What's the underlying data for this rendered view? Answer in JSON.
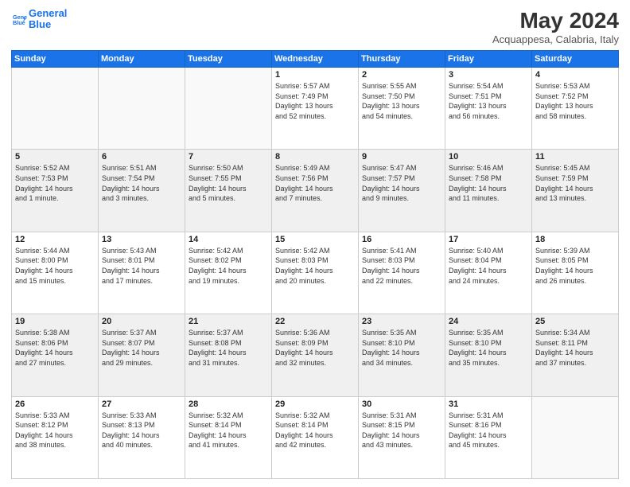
{
  "header": {
    "logo_line1": "General",
    "logo_line2": "Blue",
    "title": "May 2024",
    "subtitle": "Acquappesa, Calabria, Italy"
  },
  "columns": [
    "Sunday",
    "Monday",
    "Tuesday",
    "Wednesday",
    "Thursday",
    "Friday",
    "Saturday"
  ],
  "rows": [
    {
      "shaded": false,
      "days": [
        {
          "num": "",
          "info": ""
        },
        {
          "num": "",
          "info": ""
        },
        {
          "num": "",
          "info": ""
        },
        {
          "num": "1",
          "info": "Sunrise: 5:57 AM\nSunset: 7:49 PM\nDaylight: 13 hours\nand 52 minutes."
        },
        {
          "num": "2",
          "info": "Sunrise: 5:55 AM\nSunset: 7:50 PM\nDaylight: 13 hours\nand 54 minutes."
        },
        {
          "num": "3",
          "info": "Sunrise: 5:54 AM\nSunset: 7:51 PM\nDaylight: 13 hours\nand 56 minutes."
        },
        {
          "num": "4",
          "info": "Sunrise: 5:53 AM\nSunset: 7:52 PM\nDaylight: 13 hours\nand 58 minutes."
        }
      ]
    },
    {
      "shaded": true,
      "days": [
        {
          "num": "5",
          "info": "Sunrise: 5:52 AM\nSunset: 7:53 PM\nDaylight: 14 hours\nand 1 minute."
        },
        {
          "num": "6",
          "info": "Sunrise: 5:51 AM\nSunset: 7:54 PM\nDaylight: 14 hours\nand 3 minutes."
        },
        {
          "num": "7",
          "info": "Sunrise: 5:50 AM\nSunset: 7:55 PM\nDaylight: 14 hours\nand 5 minutes."
        },
        {
          "num": "8",
          "info": "Sunrise: 5:49 AM\nSunset: 7:56 PM\nDaylight: 14 hours\nand 7 minutes."
        },
        {
          "num": "9",
          "info": "Sunrise: 5:47 AM\nSunset: 7:57 PM\nDaylight: 14 hours\nand 9 minutes."
        },
        {
          "num": "10",
          "info": "Sunrise: 5:46 AM\nSunset: 7:58 PM\nDaylight: 14 hours\nand 11 minutes."
        },
        {
          "num": "11",
          "info": "Sunrise: 5:45 AM\nSunset: 7:59 PM\nDaylight: 14 hours\nand 13 minutes."
        }
      ]
    },
    {
      "shaded": false,
      "days": [
        {
          "num": "12",
          "info": "Sunrise: 5:44 AM\nSunset: 8:00 PM\nDaylight: 14 hours\nand 15 minutes."
        },
        {
          "num": "13",
          "info": "Sunrise: 5:43 AM\nSunset: 8:01 PM\nDaylight: 14 hours\nand 17 minutes."
        },
        {
          "num": "14",
          "info": "Sunrise: 5:42 AM\nSunset: 8:02 PM\nDaylight: 14 hours\nand 19 minutes."
        },
        {
          "num": "15",
          "info": "Sunrise: 5:42 AM\nSunset: 8:03 PM\nDaylight: 14 hours\nand 20 minutes."
        },
        {
          "num": "16",
          "info": "Sunrise: 5:41 AM\nSunset: 8:03 PM\nDaylight: 14 hours\nand 22 minutes."
        },
        {
          "num": "17",
          "info": "Sunrise: 5:40 AM\nSunset: 8:04 PM\nDaylight: 14 hours\nand 24 minutes."
        },
        {
          "num": "18",
          "info": "Sunrise: 5:39 AM\nSunset: 8:05 PM\nDaylight: 14 hours\nand 26 minutes."
        }
      ]
    },
    {
      "shaded": true,
      "days": [
        {
          "num": "19",
          "info": "Sunrise: 5:38 AM\nSunset: 8:06 PM\nDaylight: 14 hours\nand 27 minutes."
        },
        {
          "num": "20",
          "info": "Sunrise: 5:37 AM\nSunset: 8:07 PM\nDaylight: 14 hours\nand 29 minutes."
        },
        {
          "num": "21",
          "info": "Sunrise: 5:37 AM\nSunset: 8:08 PM\nDaylight: 14 hours\nand 31 minutes."
        },
        {
          "num": "22",
          "info": "Sunrise: 5:36 AM\nSunset: 8:09 PM\nDaylight: 14 hours\nand 32 minutes."
        },
        {
          "num": "23",
          "info": "Sunrise: 5:35 AM\nSunset: 8:10 PM\nDaylight: 14 hours\nand 34 minutes."
        },
        {
          "num": "24",
          "info": "Sunrise: 5:35 AM\nSunset: 8:10 PM\nDaylight: 14 hours\nand 35 minutes."
        },
        {
          "num": "25",
          "info": "Sunrise: 5:34 AM\nSunset: 8:11 PM\nDaylight: 14 hours\nand 37 minutes."
        }
      ]
    },
    {
      "shaded": false,
      "days": [
        {
          "num": "26",
          "info": "Sunrise: 5:33 AM\nSunset: 8:12 PM\nDaylight: 14 hours\nand 38 minutes."
        },
        {
          "num": "27",
          "info": "Sunrise: 5:33 AM\nSunset: 8:13 PM\nDaylight: 14 hours\nand 40 minutes."
        },
        {
          "num": "28",
          "info": "Sunrise: 5:32 AM\nSunset: 8:14 PM\nDaylight: 14 hours\nand 41 minutes."
        },
        {
          "num": "29",
          "info": "Sunrise: 5:32 AM\nSunset: 8:14 PM\nDaylight: 14 hours\nand 42 minutes."
        },
        {
          "num": "30",
          "info": "Sunrise: 5:31 AM\nSunset: 8:15 PM\nDaylight: 14 hours\nand 43 minutes."
        },
        {
          "num": "31",
          "info": "Sunrise: 5:31 AM\nSunset: 8:16 PM\nDaylight: 14 hours\nand 45 minutes."
        },
        {
          "num": "",
          "info": ""
        }
      ]
    }
  ]
}
